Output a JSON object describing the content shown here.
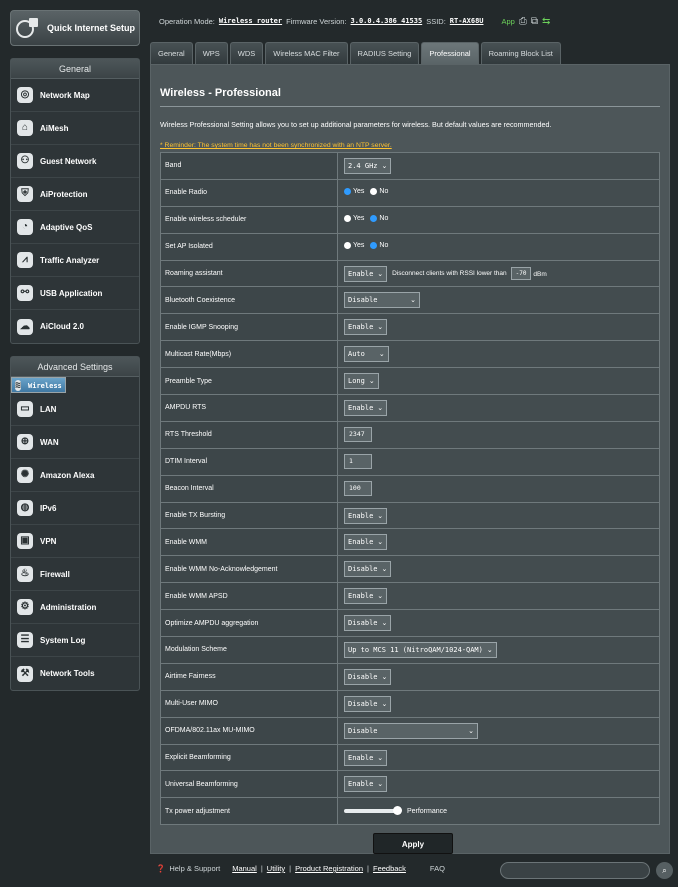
{
  "quick_setup": {
    "label": "Quick Internet Setup"
  },
  "sidebar": {
    "general_header": "General",
    "general_items": [
      {
        "label": "Network Map",
        "icon": "network-map-icon"
      },
      {
        "label": "AiMesh",
        "icon": "aimesh-icon"
      },
      {
        "label": "Guest Network",
        "icon": "guest-network-icon"
      },
      {
        "label": "AiProtection",
        "icon": "aiprotection-icon"
      },
      {
        "label": "Adaptive QoS",
        "icon": "adaptive-qos-icon"
      },
      {
        "label": "Traffic Analyzer",
        "icon": "traffic-analyzer-icon"
      },
      {
        "label": "USB Application",
        "icon": "usb-icon"
      },
      {
        "label": "AiCloud 2.0",
        "icon": "cloud-icon"
      }
    ],
    "advanced_header": "Advanced Settings",
    "advanced_items": [
      {
        "label": "Wireless",
        "icon": "wireless-icon",
        "selected": true
      },
      {
        "label": "LAN",
        "icon": "lan-icon"
      },
      {
        "label": "WAN",
        "icon": "wan-icon"
      },
      {
        "label": "Amazon Alexa",
        "icon": "alexa-icon"
      },
      {
        "label": "IPv6",
        "icon": "ipv6-icon"
      },
      {
        "label": "VPN",
        "icon": "vpn-icon"
      },
      {
        "label": "Firewall",
        "icon": "firewall-icon"
      },
      {
        "label": "Administration",
        "icon": "administration-icon"
      },
      {
        "label": "System Log",
        "icon": "system-log-icon"
      },
      {
        "label": "Network Tools",
        "icon": "network-tools-icon"
      }
    ]
  },
  "topbar": {
    "op_mode_label": "Operation Mode:",
    "op_mode_value": "Wireless router",
    "firmware_label": "Firmware Version:",
    "firmware_value": "3.0.0.4.386_41535",
    "ssid_label": "SSID:",
    "ssid_value": "RT-AX68U",
    "app_label": "App"
  },
  "tabs": [
    {
      "label": "General"
    },
    {
      "label": "WPS"
    },
    {
      "label": "WDS"
    },
    {
      "label": "Wireless MAC Filter"
    },
    {
      "label": "RADIUS Setting"
    },
    {
      "label": "Professional",
      "active": true
    },
    {
      "label": "Roaming Block List"
    }
  ],
  "panel": {
    "title": "Wireless - Professional",
    "description": "Wireless Professional Setting allows you to set up additional parameters for wireless. But default values are recommended.",
    "reminder": "* Reminder: The system time has not been synchronized with an NTP server."
  },
  "settings": {
    "band": {
      "label": "Band",
      "value": "2.4 GHz"
    },
    "enable_radio": {
      "label": "Enable Radio",
      "yes": "Yes",
      "no": "No"
    },
    "wireless_scheduler": {
      "label": "Enable wireless scheduler",
      "yes": "Yes",
      "no": "No"
    },
    "ap_isolated": {
      "label": "Set AP Isolated",
      "yes": "Yes",
      "no": "No"
    },
    "roaming": {
      "label": "Roaming assistant",
      "value": "Enable",
      "text": "Disconnect clients with RSSI lower than",
      "rssi": "-70",
      "unit": "dBm"
    },
    "bt_coexistence": {
      "label": "Bluetooth Coexistence",
      "value": "Disable"
    },
    "igmp_snooping": {
      "label": "Enable IGMP Snooping",
      "value": "Enable"
    },
    "multicast_rate": {
      "label": "Multicast Rate(Mbps)",
      "value": "Auto"
    },
    "preamble": {
      "label": "Preamble Type",
      "value": "Long"
    },
    "ampdu_rts": {
      "label": "AMPDU RTS",
      "value": "Enable"
    },
    "rts_threshold": {
      "label": "RTS Threshold",
      "value": "2347"
    },
    "dtim": {
      "label": "DTIM Interval",
      "value": "1"
    },
    "beacon": {
      "label": "Beacon Interval",
      "value": "100"
    },
    "tx_bursting": {
      "label": "Enable TX Bursting",
      "value": "Enable"
    },
    "wmm": {
      "label": "Enable WMM",
      "value": "Enable"
    },
    "wmm_noack": {
      "label": "Enable WMM No-Acknowledgement",
      "value": "Disable"
    },
    "wmm_apsd": {
      "label": "Enable WMM APSD",
      "value": "Enable"
    },
    "ampdu_agg": {
      "label": "Optimize AMPDU aggregation",
      "value": "Disable"
    },
    "modulation": {
      "label": "Modulation Scheme",
      "value": "Up to MCS 11 (NitroQAM/1024-QAM)"
    },
    "airtime": {
      "label": "Airtime Fairness",
      "value": "Disable"
    },
    "mu_mimo": {
      "label": "Multi-User MIMO",
      "value": "Disable"
    },
    "ofdma": {
      "label": "OFDMA/802.11ax MU-MIMO",
      "value": "Disable"
    },
    "explicit_bf": {
      "label": "Explicit Beamforming",
      "value": "Enable"
    },
    "universal_bf": {
      "label": "Universal Beamforming",
      "value": "Enable"
    },
    "tx_power": {
      "label": "Tx power adjustment",
      "value_text": "Performance",
      "level": 1.0
    }
  },
  "apply_label": "Apply",
  "footer": {
    "help": "Help & Support",
    "manual": "Manual",
    "utility": "Utility",
    "product_registration": "Product Registration",
    "feedback": "Feedback",
    "faq": "FAQ",
    "sep": "|"
  }
}
